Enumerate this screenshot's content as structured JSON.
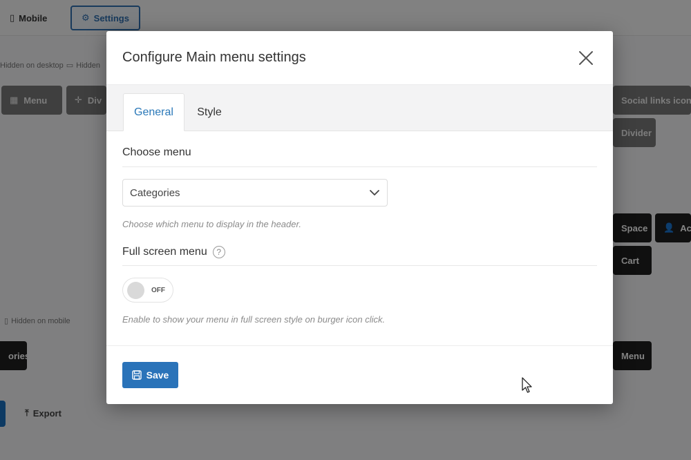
{
  "background": {
    "tabs": {
      "mobile": "Mobile",
      "settings": "Settings"
    },
    "hint_desktop": "Hidden on desktop",
    "hint_desktop_2": "Hidden",
    "hint_mobile": "Hidden on mobile",
    "chips": {
      "menu": "Menu",
      "divider_partial": "Div",
      "social_links": "Social links icons",
      "divider": "Divider",
      "space": "Space",
      "account_partial": "Ac",
      "cart": "Cart",
      "categories_partial": "ories",
      "menu_2": "Menu"
    },
    "export": "Export"
  },
  "modal": {
    "title": "Configure Main menu settings",
    "tabs": [
      {
        "label": "General",
        "active": true
      },
      {
        "label": "Style",
        "active": false
      }
    ],
    "choose_menu": {
      "title": "Choose menu",
      "selected": "Categories",
      "help": "Choose which menu to display in the header."
    },
    "full_screen": {
      "title": "Full screen menu",
      "help_icon": "question-icon",
      "toggle_state": "OFF",
      "help": "Enable to show your menu in full screen style on burger icon click."
    },
    "save_label": "Save"
  },
  "colors": {
    "accent": "#2a73b9",
    "tab_active_text": "#2a78b8"
  }
}
